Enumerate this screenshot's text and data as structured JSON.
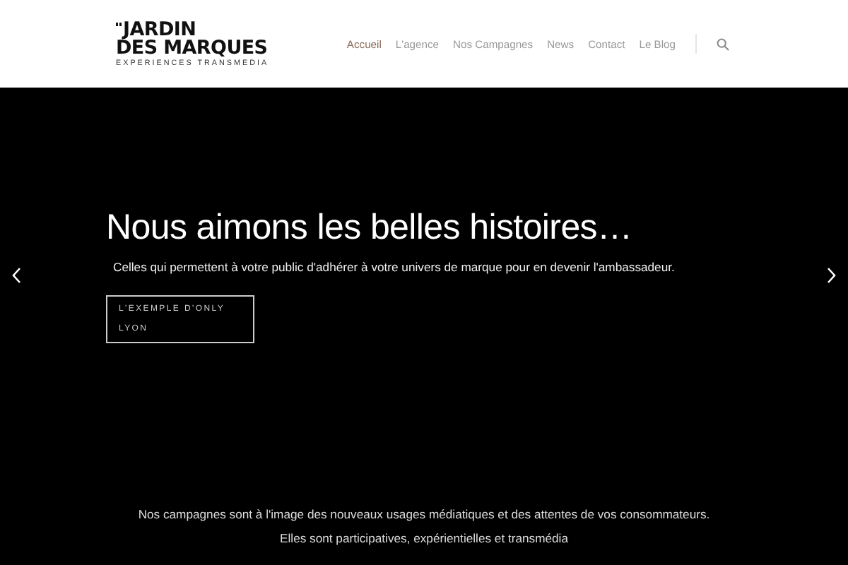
{
  "logo": {
    "line_1": "JARDIN",
    "line_2": "DES MARQUES",
    "tagline": "EXPERIENCES TRANSMEDIA"
  },
  "nav": [
    {
      "label": "Accueil",
      "selected": true
    },
    {
      "label": "L'agence",
      "selected": false
    },
    {
      "label": "Nos Campagnes",
      "selected": false
    },
    {
      "label": "News",
      "selected": false
    },
    {
      "label": "Contact",
      "selected": false
    },
    {
      "label": "Le Blog",
      "selected": false
    }
  ],
  "slider": {
    "title": "Nous aimons les belles histoires…",
    "subtitle": "Celles qui permettent à votre public d'adhérer à votre univers de marque pour en devenir l'ambassadeur.",
    "button": "L'EXEMPLE D'ONLY LYON"
  },
  "intro": [
    "Nos campagnes sont à l'image des nouveaux usages médiatiques et des attentes de vos consommateurs.",
    "Elles sont participatives, expérientielles et transmédia"
  ]
}
